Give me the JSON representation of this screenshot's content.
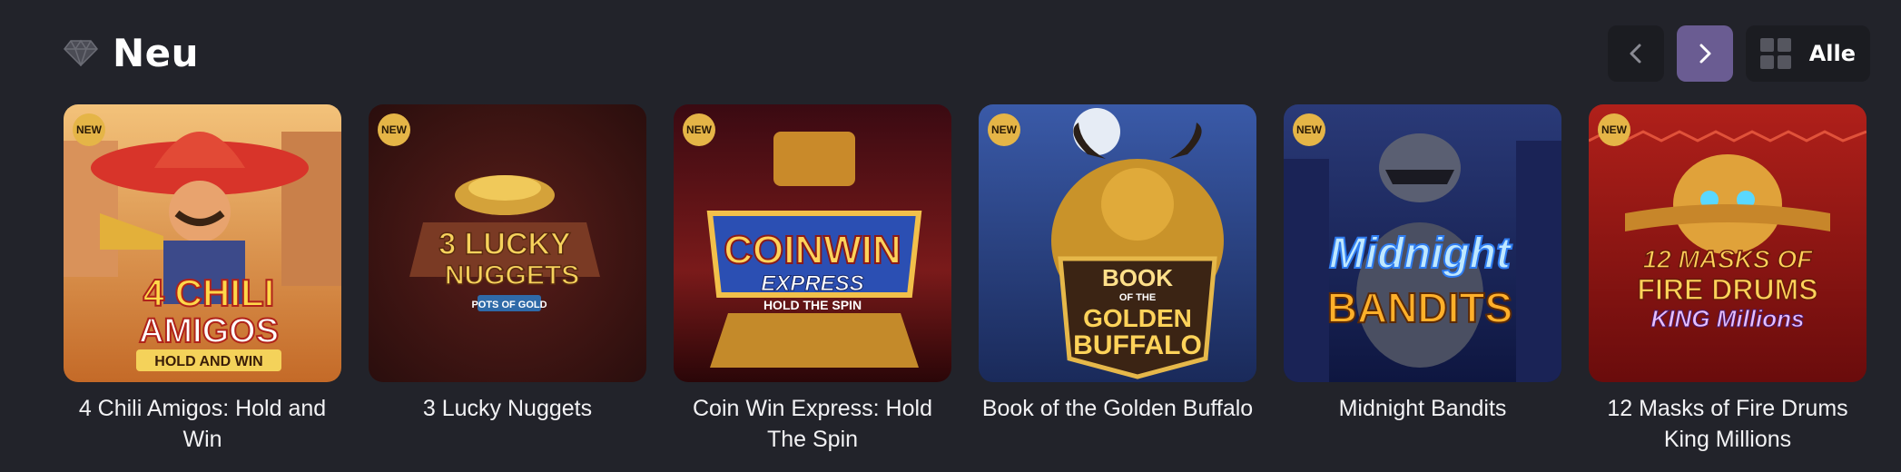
{
  "section": {
    "title": "Neu",
    "icon": "diamond-icon",
    "all_label": "Alle"
  },
  "badge_label": "NEW",
  "colors": {
    "background": "#22232a",
    "button_dark": "#1b1c21",
    "button_accent": "#6a5c92",
    "badge": "#e5b547"
  },
  "games": [
    {
      "title": "4 Chili Amigos: Hold and Win",
      "logo_lines": [
        "4 CHILI",
        "AMIGOS",
        "HOLD AND WIN"
      ]
    },
    {
      "title": "3 Lucky Nuggets",
      "logo_lines": [
        "3 LUCKY",
        "NUGGETS",
        "POTS OF GOLD"
      ]
    },
    {
      "title": "Coin Win Express: Hold The Spin",
      "logo_lines": [
        "COINWIN",
        "EXPRESS",
        "HOLD THE SPIN"
      ]
    },
    {
      "title": "Book of the Golden Buffalo",
      "logo_lines": [
        "BOOK",
        "OF THE",
        "GOLDEN",
        "BUFFALO"
      ]
    },
    {
      "title": "Midnight Bandits",
      "logo_lines": [
        "Midnight",
        "BANDITS"
      ]
    },
    {
      "title": "12 Masks of Fire Drums King Millions",
      "logo_lines": [
        "12 MASKS OF",
        "FIRE DRUMS",
        "KING Millions"
      ]
    }
  ]
}
